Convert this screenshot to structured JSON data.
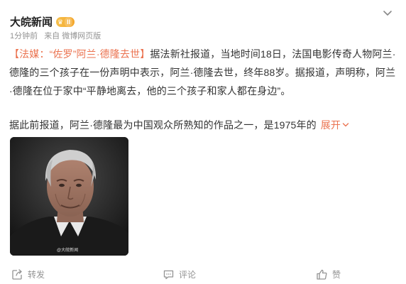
{
  "post": {
    "account_name": "大皖新闻",
    "vip_level": "II",
    "time": "1分钟前",
    "source": "来自 微博网页版",
    "topic": "【法媒：“佐罗”阿兰·德隆去世】",
    "body_lead": "据法新社报道，当地时间18日，法国电影传奇人物阿兰·德隆的三个孩子在一份声明中表示，阿兰·德隆去世，终年88岁。据报道，声明称，阿兰·德隆在位于家中“平静地离去，他的三个孩子和家人都在身边”。",
    "body_second": "据此前报道，阿兰·德隆最为中国观众所熟知的作品之一，是1975年的",
    "expand_label": "展开",
    "watermark": "@大皖新闻"
  },
  "actions": {
    "repost_label": "转发",
    "comment_label": "评论",
    "like_label": "赞"
  },
  "colors": {
    "accent": "#eb7350",
    "meta_gray": "#939393",
    "vip_gold": "#f4a62a"
  },
  "icons": [
    "crown-icon",
    "chevron-down-icon",
    "repost-icon",
    "comment-icon",
    "like-icon"
  ]
}
